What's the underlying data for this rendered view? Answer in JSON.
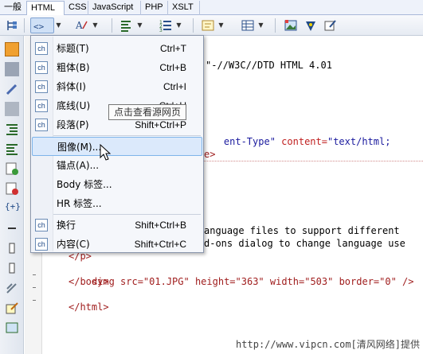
{
  "tabs": [
    "一般",
    "HTML",
    "CSS",
    "JavaScript",
    "PHP",
    "XSLT"
  ],
  "active_tab": "HTML",
  "toolbar_icons": [
    "tag-icon",
    "font-icon",
    "align-icon",
    "list-icon",
    "form-icon",
    "table-icon",
    "image-icon",
    "color-icon",
    "edit-icon"
  ],
  "code": {
    "line1": "\"-//W3C//DTD HTML 4.01",
    "line_meta_attr": "ent-Type\"",
    "line_meta_content": "content=",
    "line_meta_val": "\"text/html;",
    "line_close": "e>",
    "line_lang1": "anguage files to support different ",
    "line_lang2": "d-ons dialog to change language use",
    "line_p_close": "</p>",
    "line_img": "<img src=\"01.JPG\" height=\"363\" width=\"503\" border=\"0\" />",
    "line_body_close": "</body>",
    "line_html_close": "</html>"
  },
  "menu": {
    "items": [
      {
        "label": "标题(T)",
        "shortcut": "Ctrl+T",
        "icon": "ch"
      },
      {
        "label": "粗体(B)",
        "shortcut": "Ctrl+B",
        "icon": "ch"
      },
      {
        "label": "斜体(I)",
        "shortcut": "Ctrl+I",
        "icon": "ch"
      },
      {
        "label": "底线(U)",
        "shortcut": "Ctrl+U",
        "icon": "ch"
      },
      {
        "label": "段落(P)",
        "shortcut": "Shift+Ctrl+P",
        "icon": "ch"
      },
      {
        "label": "图像(M)...",
        "shortcut": "",
        "icon": ""
      },
      {
        "label": "锚点(A)...",
        "shortcut": "",
        "icon": ""
      },
      {
        "label": "Body 标签...",
        "shortcut": "",
        "icon": ""
      },
      {
        "label": "HR 标签...",
        "shortcut": "",
        "icon": ""
      },
      {
        "label": "换行",
        "shortcut": "Shift+Ctrl+B",
        "icon": "ch"
      },
      {
        "label": "内容(C)",
        "shortcut": "Shift+Ctrl+C",
        "icon": "ch"
      }
    ]
  },
  "tooltip": "点击查看源网页",
  "watermark": "http://www.vipcn.com[清风网络]提供"
}
